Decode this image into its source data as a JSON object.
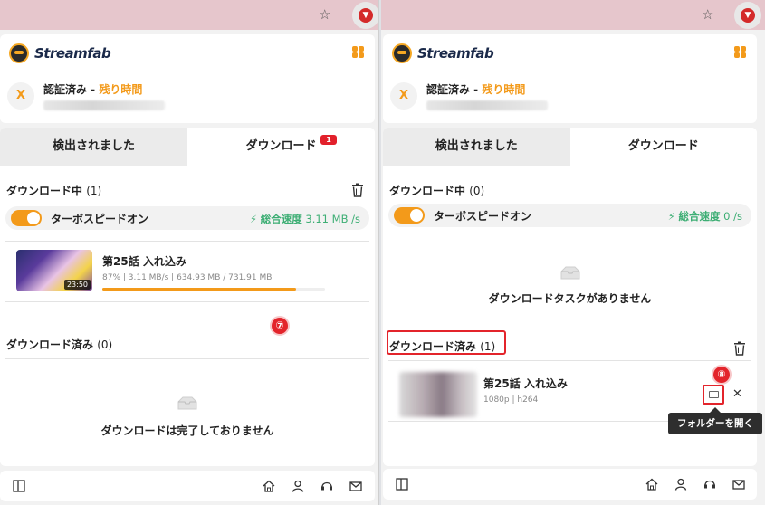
{
  "left": {
    "logo_text": "Streamfab",
    "auth_status": "認証済み -",
    "auth_remaining": "残り時間",
    "avatar_letter": "X",
    "tab_detected": "検出されました",
    "tab_download": "ダウンロード",
    "tab_download_badge": "1",
    "downloading_title": "ダウンロード中",
    "downloading_count": "(1)",
    "turbo_label": "ターボスピードオン",
    "speed_label": "総合速度",
    "speed_value": "3.11 MB /s",
    "item_title": "第25話 入れ込み",
    "item_meta": "87% | 3.11 MB/s | 634.93 MB / 731.91 MB",
    "item_duration": "23:50",
    "item_progress": 0.87,
    "step_marker": "⑦",
    "downloaded_title": "ダウンロード済み",
    "downloaded_count": "(0)",
    "downloaded_empty": "ダウンロードは完了しておりません"
  },
  "right": {
    "logo_text": "Streamfab",
    "auth_status": "認証済み -",
    "auth_remaining": "残り時間",
    "avatar_letter": "X",
    "tab_detected": "検出されました",
    "tab_download": "ダウンロード",
    "downloading_title": "ダウンロード中",
    "downloading_count": "(0)",
    "turbo_label": "ターボスピードオン",
    "speed_label": "総合速度",
    "speed_value": "0 /s",
    "downloading_empty": "ダウンロードタスクがありません",
    "downloaded_title": "ダウンロード済み",
    "downloaded_count": "(1)",
    "item_title": "第25話 入れ込み",
    "item_meta": "1080p | h264",
    "step_marker": "⑧",
    "tooltip": "フォルダーを開く",
    "close_symbol": "✕"
  },
  "colors": {
    "accent": "#f39a1a",
    "speed_green": "#3dae74",
    "highlight_red": "#e3242b",
    "browser_bar": "#e6c6cc"
  },
  "icons": [
    "star-icon",
    "extension-download-icon",
    "streamfab-logo-icon",
    "grid-menu-icon",
    "trash-icon",
    "bolt-icon",
    "empty-box-icon",
    "folder-icon",
    "close-icon",
    "sidebar-icon",
    "home-icon",
    "user-icon",
    "headset-icon",
    "mail-icon"
  ]
}
